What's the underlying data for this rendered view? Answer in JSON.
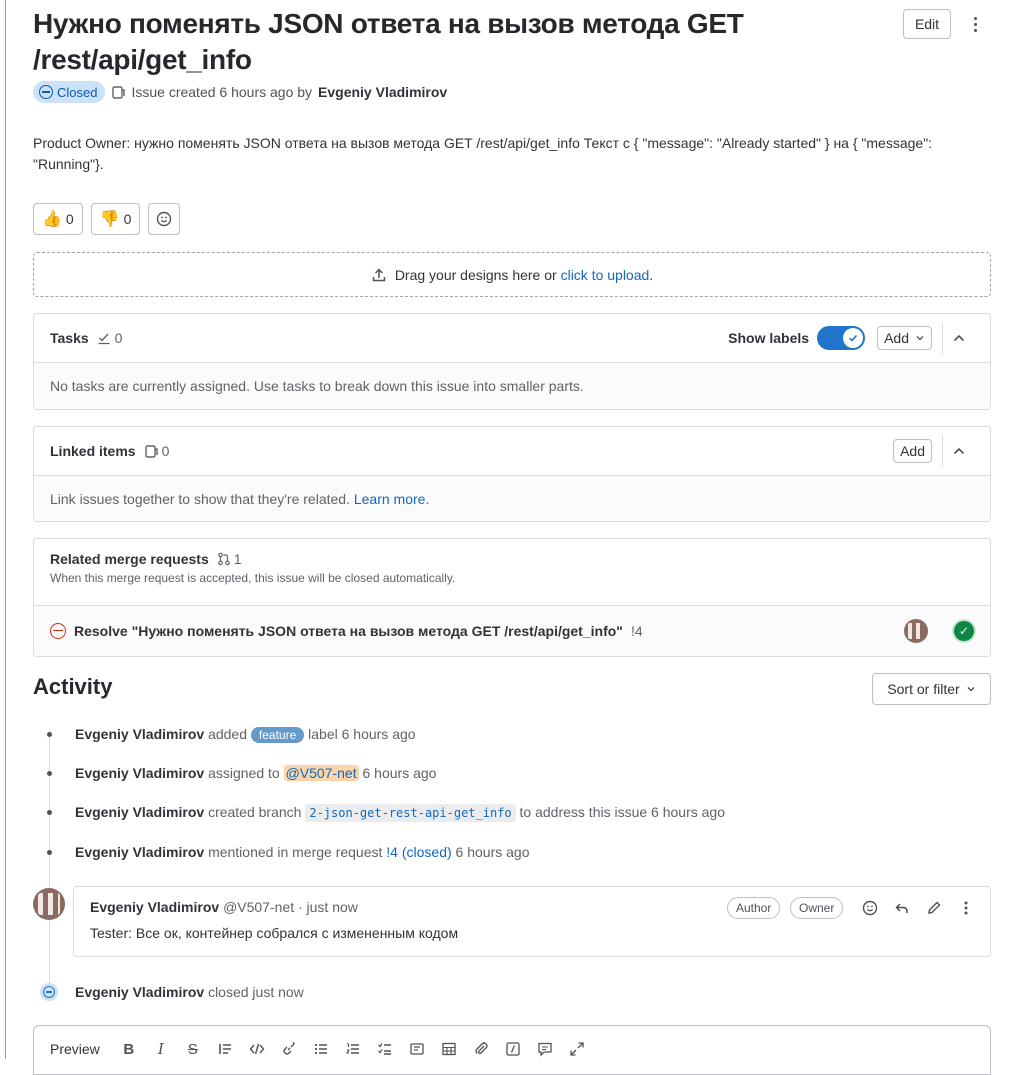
{
  "issue": {
    "title": "Нужно поменять JSON ответа на вызов метода GET /rest/api/get_info",
    "edit_label": "Edit",
    "status": "Closed",
    "meta_prefix": "Issue created 6 hours ago by",
    "author": "Evgeniy Vladimirov",
    "description": "Product Owner: нужно поменять JSON ответа на вызов метода GET /rest/api/get_info Текст с { \"message\": \"Already started\" } на { \"message\": \"Running\"}."
  },
  "reactions": [
    {
      "emoji": "👍",
      "count": "0"
    },
    {
      "emoji": "👎",
      "count": "0"
    }
  ],
  "dropzone": {
    "text": "Drag your designs here or",
    "link": "click to upload",
    "suffix": "."
  },
  "tasks": {
    "title": "Tasks",
    "count": "0",
    "show_labels": "Show labels",
    "add_label": "Add",
    "empty": "No tasks are currently assigned. Use tasks to break down this issue into smaller parts."
  },
  "linked": {
    "title": "Linked items",
    "count": "0",
    "add_label": "Add",
    "empty": "Link issues together to show that they're related.",
    "learn_more": "Learn more",
    "suffix": "."
  },
  "related_mr": {
    "title": "Related merge requests",
    "count": "1",
    "subtitle": "When this merge request is accepted, this issue will be closed automatically.",
    "item_title": "Resolve \"Нужно поменять JSON ответа на вызов метода GET /rest/api/get_info\"",
    "item_ref": "!4"
  },
  "activity": {
    "title": "Activity",
    "sort_label": "Sort or filter",
    "events": [
      {
        "actor": "Evgeniy Vladimirov",
        "pre": "added",
        "label": "feature",
        "post": "label 6 hours ago"
      },
      {
        "actor": "Evgeniy Vladimirov",
        "pre": "assigned to",
        "mention": "@V507-net",
        "post": "6 hours ago"
      },
      {
        "actor": "Evgeniy Vladimirov",
        "pre": "created branch",
        "branch": "2-json-get-rest-api-get_info",
        "post": "to address this issue 6 hours ago"
      },
      {
        "actor": "Evgeniy Vladimirov",
        "pre": "mentioned in merge request",
        "link": "!4 (closed)",
        "post": "6 hours ago"
      }
    ],
    "note": {
      "author": "Evgeniy Vladimirov",
      "handle": "@V507-net · just now",
      "badge_author": "Author",
      "badge_owner": "Owner",
      "body": "Tester: Все ок, контейнер собрался с измененным кодом"
    },
    "closed_event": {
      "actor": "Evgeniy Vladimirov",
      "text": "closed just now"
    }
  },
  "editor": {
    "preview_label": "Preview"
  }
}
